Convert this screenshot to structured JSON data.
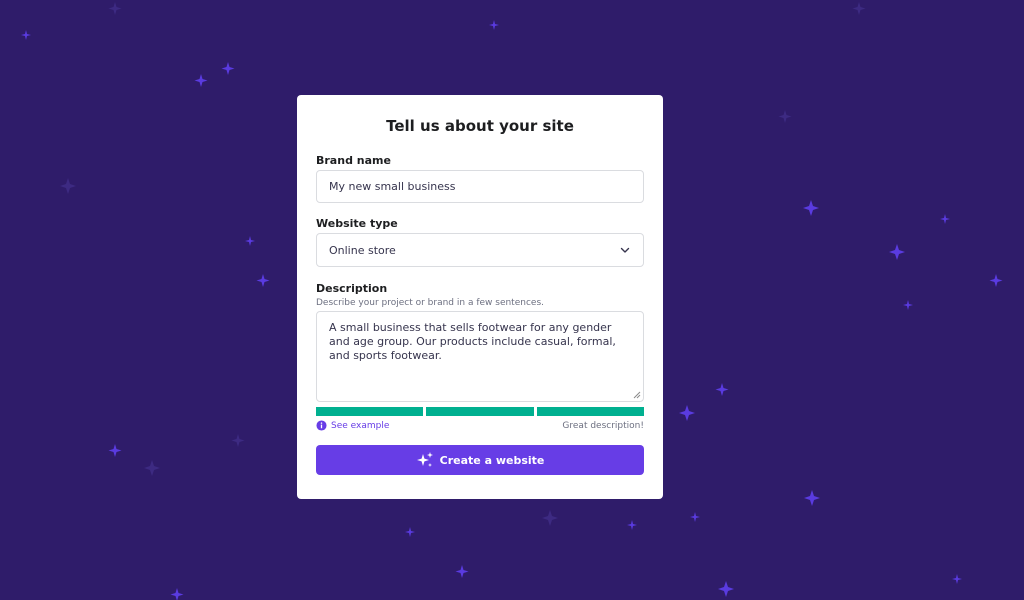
{
  "colors": {
    "background": "#2f1c6a",
    "accent": "#673de6",
    "success": "#00b090",
    "star": "#5a3be0"
  },
  "card": {
    "title": "Tell us about your site",
    "brand": {
      "label": "Brand name",
      "value": "My new small business"
    },
    "website_type": {
      "label": "Website type",
      "selected": "Online store"
    },
    "description": {
      "label": "Description",
      "helper": "Describe your project or brand in a few sentences.",
      "value": "A small business that sells footwear for any gender and age group. Our products include casual, formal, and sports footwear.",
      "quality_filled_segments": 3,
      "quality_total_segments": 3,
      "see_example": "See example",
      "status": "Great description!"
    },
    "create_button": "Create a website"
  },
  "icons": {
    "select": "chevron-down-icon",
    "info": "info-icon",
    "button": "sparkles-icon"
  }
}
